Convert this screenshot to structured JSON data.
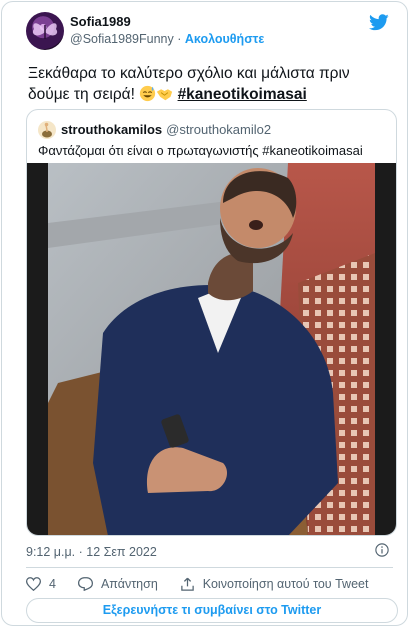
{
  "author": {
    "display_name": "Sofia1989",
    "handle": "@Sofia1989Funny",
    "separator": "·",
    "follow_label": "Ακολουθήστε"
  },
  "tweet": {
    "text": "Ξεκάθαρα το καλύτερο σχόλιο και μάλιστα πριν δούμε τη σειρά!",
    "emojis": [
      "sweat-smile-emoji",
      "handshake-emoji"
    ],
    "hashtag": "#kaneotikoimasai"
  },
  "quoted_tweet": {
    "display_name": "strouthokamilos",
    "handle": "@strouthokamilo2",
    "text": "Φαντάζομαι ότι είναι ο πρωταγωνιστής  #kaneotikoimasai"
  },
  "meta": {
    "timestamp": "9:12 μ.μ. · 12 Σεπ 2022"
  },
  "actions": {
    "like_count": "4",
    "reply_label": "Απάντηση",
    "share_label": "Κοινοποίηση αυτού του Tweet"
  },
  "explore_label": "Εξερευνήστε τι συμβαίνει στο Twitter",
  "colors": {
    "accent": "#1d9bf0",
    "border": "#cfd9de",
    "muted_text": "#536471",
    "text": "#0f1419"
  }
}
